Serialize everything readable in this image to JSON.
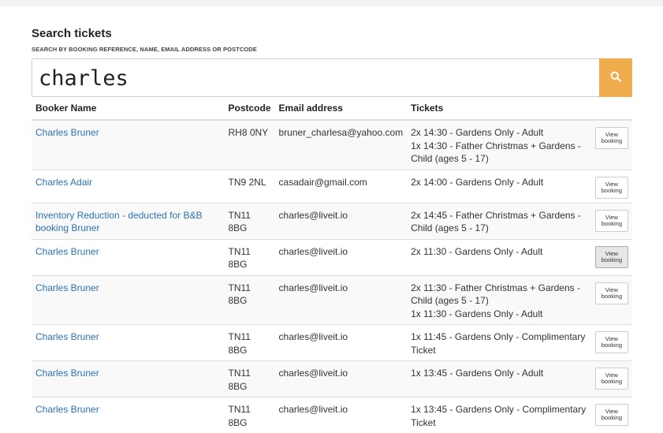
{
  "page": {
    "title": "Search tickets",
    "subtitle": "SEARCH BY BOOKING REFERENCE, NAME, EMAIL ADDRESS OR POSTCODE"
  },
  "search": {
    "value": "charles"
  },
  "table": {
    "headers": [
      "Booker Name",
      "Postcode",
      "Email address",
      "Tickets",
      ""
    ],
    "action_label": "View booking",
    "rows": [
      {
        "name": "Charles Bruner",
        "postcode": "RH8 0NY",
        "email": "bruner_charlesa@yahoo.com",
        "tickets": [
          "2x 14:30 - Gardens Only - Adult",
          "1x 14:30 - Father Christmas + Gardens - Child (ages 5 - 17)"
        ]
      },
      {
        "name": "Charles Adair",
        "postcode": "TN9 2NL",
        "email": "casadair@gmail.com",
        "tickets": [
          "2x 14:00 - Gardens Only - Adult"
        ]
      },
      {
        "name": "Inventory Reduction - deducted for B&B booking Bruner",
        "postcode": "TN11 8BG",
        "email": "charles@liveit.io",
        "tickets": [
          "2x 14:45 - Father Christmas + Gardens - Child (ages 5 - 17)"
        ]
      },
      {
        "name": "Charles Bruner",
        "postcode": "TN11 8BG",
        "email": "charles@liveit.io",
        "tickets": [
          "2x 11:30 - Gardens Only - Adult"
        ]
      },
      {
        "name": "Charles Bruner",
        "postcode": "TN11 8BG",
        "email": "charles@liveit.io",
        "tickets": [
          "2x 11:30 - Father Christmas + Gardens - Child (ages 5 - 17)",
          "1x 11:30 - Gardens Only - Adult"
        ]
      },
      {
        "name": "Charles Bruner",
        "postcode": "TN11 8BG",
        "email": "charles@liveit.io",
        "tickets": [
          "1x 11:45 - Gardens Only - Complimentary Ticket"
        ]
      },
      {
        "name": "Charles Bruner",
        "postcode": "TN11 8BG",
        "email": "charles@liveit.io",
        "tickets": [
          "1x 13:45 - Gardens Only - Adult"
        ]
      },
      {
        "name": "Charles Bruner",
        "postcode": "TN11 8BG",
        "email": "charles@liveit.io",
        "tickets": [
          "1x 13:45 - Gardens Only - Complimentary Ticket"
        ]
      }
    ]
  },
  "colors": {
    "accent": "#f0ad4e",
    "link": "#2a72b5",
    "row_stripe": "#f9f9f9"
  },
  "icons": {
    "search_button": "search-icon"
  }
}
